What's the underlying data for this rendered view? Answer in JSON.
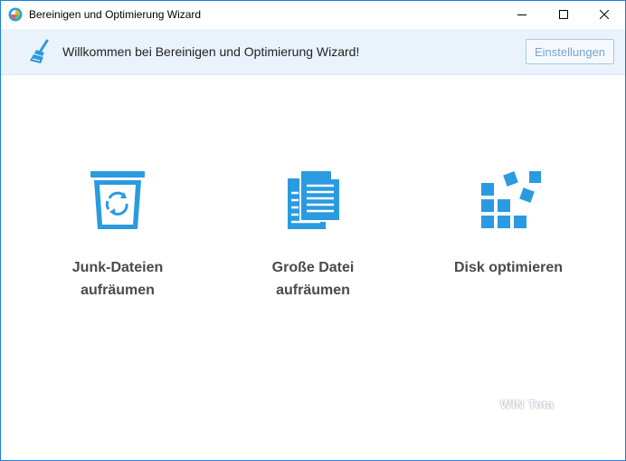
{
  "window": {
    "title": "Bereinigen und Optimierung Wizard",
    "controls": {
      "minimize": "minimize-icon",
      "maximize": "maximize-icon",
      "close": "close-icon"
    }
  },
  "banner": {
    "icon": "broom-icon",
    "welcome_text": "Willkommen bei Bereinigen und Optimierung Wizard!",
    "settings_label": "Einstellungen"
  },
  "tiles": [
    {
      "icon": "trash-recycle-icon",
      "line1": "Junk-Dateien",
      "line2": "aufräumen"
    },
    {
      "icon": "documents-icon",
      "line1": "Große Datei",
      "line2": "aufräumen"
    },
    {
      "icon": "disk-blocks-icon",
      "line1": "Disk optimieren",
      "line2": ""
    }
  ],
  "watermark": "WIN Tota",
  "colors": {
    "accent": "#2a9be0",
    "banner_bg": "#eaf3fc",
    "window_border": "#1e7fd8",
    "label_text": "#4a4a4a"
  }
}
